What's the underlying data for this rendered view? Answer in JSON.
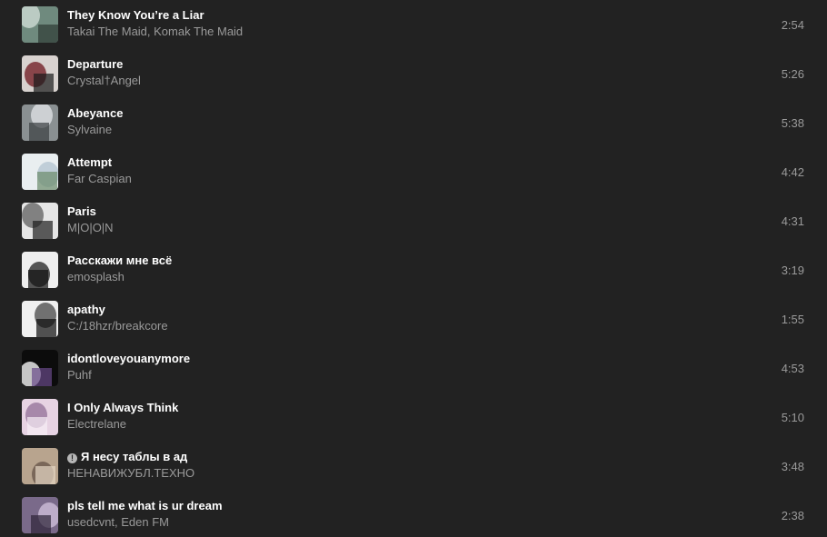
{
  "tracks": [
    {
      "title": "They Know You’re a Liar",
      "artist": "Takai The Maid, Komak The Maid",
      "duration": "2:54",
      "cover": "green-haired-anime-cover-icon",
      "colors": [
        "#6f8a7e",
        "#c9d6cf",
        "#2e3b35"
      ]
    },
    {
      "title": "Departure",
      "artist": "Crystal†Angel",
      "duration": "5:26",
      "cover": "dark-red-collage-cover-icon",
      "colors": [
        "#d8d2cf",
        "#7a2d33",
        "#1a1a1a"
      ]
    },
    {
      "title": "Abeyance",
      "artist": "Sylvaine",
      "duration": "5:38",
      "cover": "grey-foliage-cover-icon",
      "colors": [
        "#8a9092",
        "#d8dcde",
        "#3a3f42"
      ]
    },
    {
      "title": "Attempt",
      "artist": "Far Caspian",
      "duration": "4:42",
      "cover": "white-blurred-flower-cover-icon",
      "colors": [
        "#e9eef0",
        "#b8c8d4",
        "#6b8b6b"
      ]
    },
    {
      "title": "Paris",
      "artist": "M|O|O|N",
      "duration": "4:31",
      "cover": "bw-portrait-cover-icon",
      "colors": [
        "#e6e6e6",
        "#6e6e6e",
        "#1c1c1c"
      ]
    },
    {
      "title": "Расскажи мне всё",
      "artist": "emosplash",
      "duration": "3:19",
      "cover": "vinyl-disc-cover-icon",
      "colors": [
        "#efefef",
        "#3a3a3a",
        "#111111"
      ]
    },
    {
      "title": "apathy",
      "artist": "C:/18hzr/breakcore",
      "duration": "1:55",
      "cover": "bw-glitch-cover-icon",
      "colors": [
        "#f0f0f0",
        "#5a5a5a",
        "#0d0d0d"
      ]
    },
    {
      "title": "idontloveyouanymore",
      "artist": "Puhf",
      "duration": "4:53",
      "cover": "bw-anime-face-cover-icon",
      "colors": [
        "#0c0c0c",
        "#e8e8e8",
        "#6a4a8a"
      ]
    },
    {
      "title": "I Only Always Think",
      "artist": "Electrelane",
      "duration": "5:10",
      "cover": "pink-striped-cover-icon",
      "colors": [
        "#e7d3e3",
        "#9b7aa0",
        "#f6eef5"
      ]
    },
    {
      "title": "Я несу таблы в ад",
      "artist": "НЕНАВИЖУБЛ.ТЕХНО",
      "duration": "3:48",
      "cover": "beige-photo-cover-icon",
      "colors": [
        "#b8a48e",
        "#6e5d50",
        "#e5d7c4"
      ],
      "explicit": "!"
    },
    {
      "title": "pls tell me what is ur dream",
      "artist": "usedcvnt, Eden FM",
      "duration": "2:38",
      "cover": "purple-anime-cover-icon",
      "colors": [
        "#7a6a8a",
        "#c9b8d4",
        "#2e2438"
      ]
    }
  ]
}
